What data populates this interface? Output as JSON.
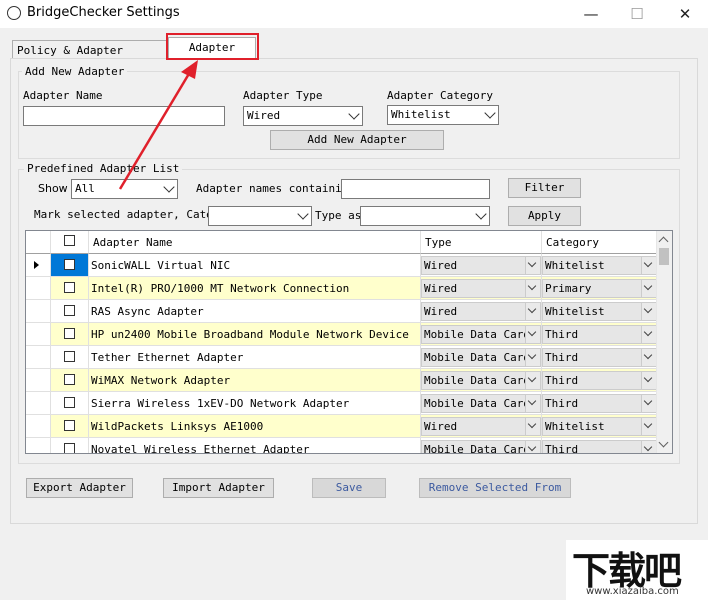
{
  "window": {
    "title": "BridgeChecker Settings",
    "minimize": "—",
    "maximize": "☐",
    "close": "✕"
  },
  "tabs": [
    "Policy & Adapter Setting",
    "Adapter List"
  ],
  "add_group": {
    "label": "Add New Adapter",
    "name_label": "Adapter Name",
    "name_value": "",
    "type_label": "Adapter Type",
    "type_value": "Wired",
    "category_label": "Adapter Category",
    "category_value": "Whitelist",
    "add_button": "Add New Adapter"
  },
  "predef_group": {
    "label": "Predefined Adapter List",
    "show_label": "Show",
    "show_value": "All",
    "names_label": "Adapter names containing",
    "names_value": "",
    "filter_button": "Filter",
    "mark_label": "Mark selected adapter, Catego",
    "mark_category_value": "",
    "type_as_label": "Type as",
    "type_as_value": "",
    "apply_button": "Apply"
  },
  "grid": {
    "headers": [
      "Adapter Name",
      "Type",
      "Category"
    ],
    "rows": [
      {
        "name": "SonicWALL Virtual NIC",
        "type": "Wired",
        "category": "Whitelist"
      },
      {
        "name": "Intel(R) PRO/1000 MT Network Connection",
        "type": "Wired",
        "category": "Primary"
      },
      {
        "name": "RAS Async Adapter",
        "type": "Wired",
        "category": "Whitelist"
      },
      {
        "name": "HP un2400 Mobile Broadband Module Network Device",
        "type": "Mobile Data Card",
        "category": "Third"
      },
      {
        "name": "Tether Ethernet Adapter",
        "type": "Mobile Data Card",
        "category": "Third"
      },
      {
        "name": "WiMAX Network Adapter",
        "type": "Mobile Data Card",
        "category": "Third"
      },
      {
        "name": "Sierra Wireless 1xEV-DO Network Adapter",
        "type": "Mobile Data Card",
        "category": "Third"
      },
      {
        "name": "WildPackets Linksys AE1000",
        "type": "Wired",
        "category": "Whitelist"
      },
      {
        "name": "Novatel Wireless Ethernet Adapter",
        "type": "Mobile Data Card",
        "category": "Third"
      }
    ]
  },
  "bottom_buttons": {
    "export": "Export Adapter",
    "import": "Import Adapter",
    "save": "Save",
    "remove": "Remove Selected From"
  },
  "colors": {
    "highlight": "#e0202b",
    "alt_row": "#ffffcc",
    "disabled_text": "#3c5aa0"
  },
  "watermark": "下载吧",
  "watermark_url": "www.xiazaiba.com"
}
